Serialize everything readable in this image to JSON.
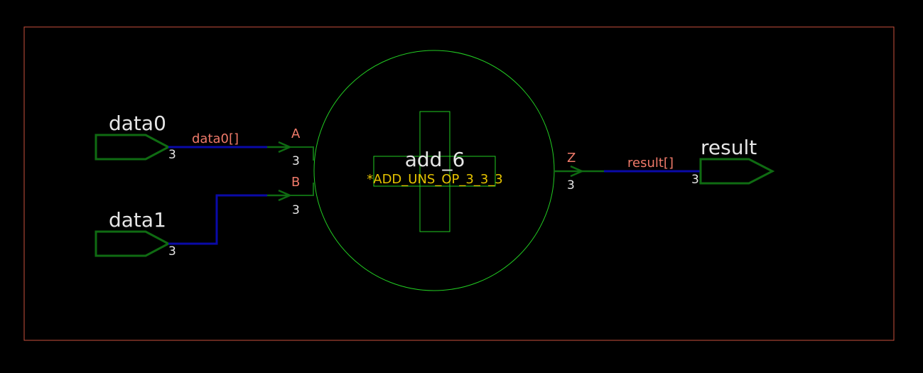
{
  "colors": {
    "background": "#000000",
    "frame": "#c8503c",
    "port": "#0f6b12",
    "wire": "#0a0aa8",
    "cell_outline": "#22cc22",
    "pin_label": "#f07a6a",
    "text": "#e6e6e6",
    "cell_type": "#e6c300"
  },
  "ports": {
    "data0": {
      "name": "data0",
      "width": "3",
      "net": "data0[]"
    },
    "data1": {
      "name": "data1",
      "width": "3"
    },
    "result": {
      "name": "result",
      "width": "3",
      "net": "result[]"
    }
  },
  "instance": {
    "name": "add_6",
    "cell": "*ADD_UNS_OP_3_3_3",
    "symbol": "plus-icon",
    "pins": {
      "A": {
        "label": "A",
        "width": "3"
      },
      "B": {
        "label": "B",
        "width": "3"
      },
      "Z": {
        "label": "Z",
        "width": "3"
      }
    }
  }
}
